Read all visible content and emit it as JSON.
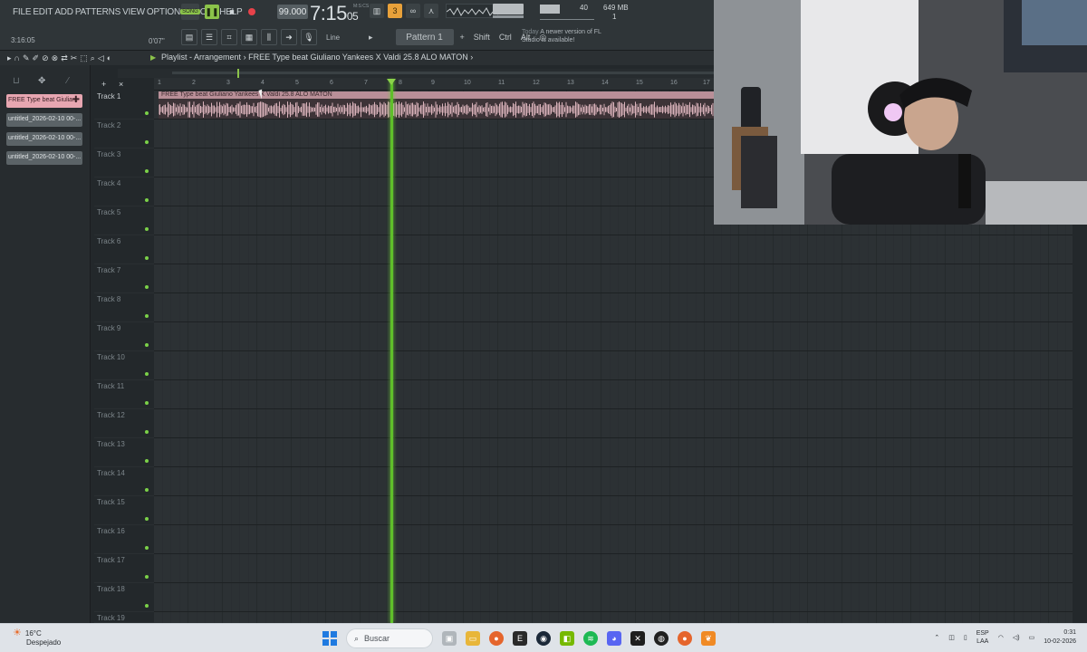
{
  "menu": [
    "FILE",
    "EDIT",
    "ADD",
    "PATTERNS",
    "VIEW",
    "OPTIONS",
    "TOOLS",
    "HELP"
  ],
  "transport": {
    "pat_song_label": "SONG",
    "tempo": "99.000",
    "song_time": "7:15",
    "song_time_sub": "05",
    "time_label": "M:S:CS",
    "position_left": "3:16:05",
    "position_small": "0'07\""
  },
  "monitor": {
    "cpu_value": "40",
    "memory": "649 MB",
    "poly": "1"
  },
  "toolbar2": {
    "snap_label": "Line",
    "pattern_label": "Pattern 1",
    "shift_label": "Shift",
    "ctrl_label": "Ctrl",
    "alt_label": "Alt"
  },
  "news": {
    "prefix": "Today",
    "text": "A newer version of FL Studio is available!"
  },
  "playlist": {
    "title": "Playlist - Arrangement",
    "separator": "›",
    "arrangement": "FREE Type beat Giuliano Yankees X Valdi 25.8 ALO MATON",
    "arrow": "›"
  },
  "picker": {
    "items": [
      "FREE Type beat Giulia...",
      "untitled_2026-02-10 00-...",
      "untitled_2026-02-10 00-...",
      "untitled_2026-02-10 00-..."
    ]
  },
  "ruler": [
    "1",
    "2",
    "3",
    "4",
    "5",
    "6",
    "7",
    "8",
    "9",
    "10",
    "11",
    "12",
    "13",
    "14",
    "15",
    "16",
    "17"
  ],
  "tracks": [
    "Track 1",
    "Track 2",
    "Track 3",
    "Track 4",
    "Track 5",
    "Track 6",
    "Track 7",
    "Track 8",
    "Track 9",
    "Track 10",
    "Track 11",
    "Track 12",
    "Track 13",
    "Track 14",
    "Track 15",
    "Track 16",
    "Track 17",
    "Track 18",
    "Track 19"
  ],
  "clip": {
    "label": "FREE Type beat Giuliano Yankees X Valdi 25.8 ALO MATON",
    "color": "#b98f98"
  },
  "taskbar": {
    "temperature": "16°C",
    "weather": "Despejado",
    "search_label": "Buscar",
    "language": "ESP",
    "language_sub": "LAA",
    "time": "0:31",
    "date": "10-02-2026"
  },
  "colors": {
    "accent_green": "#8bc34a",
    "playhead": "#5fbf2a",
    "record": "#e8424a",
    "clip": "#b98f98"
  }
}
